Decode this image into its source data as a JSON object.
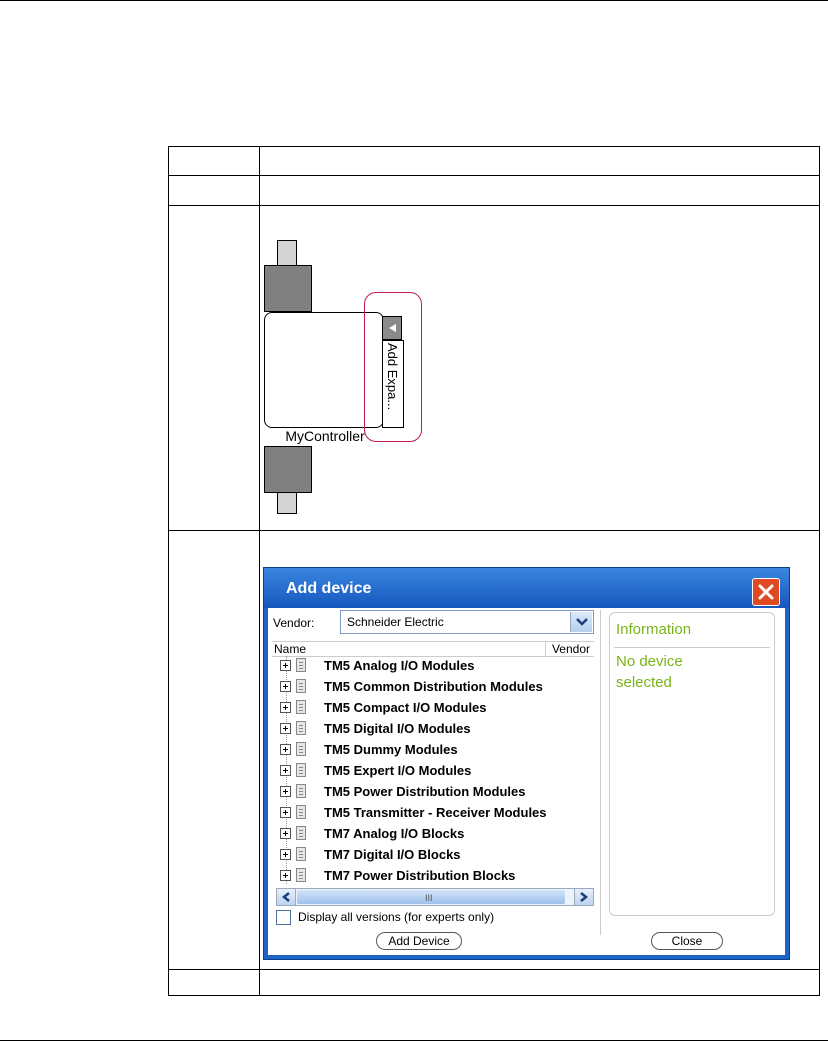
{
  "diagram": {
    "controller_label": "MyController",
    "expansion_button_label": "Add Expa..."
  },
  "dialog": {
    "title": "Add device",
    "vendor_label": "Vendor:",
    "vendor_value": "Schneider Electric",
    "columns": {
      "name": "Name",
      "vendor": "Vendor"
    },
    "tree_items": [
      "TM5 Analog I/O Modules",
      "TM5 Common Distribution Modules",
      "TM5 Compact I/O Modules",
      "TM5 Digital I/O Modules",
      "TM5 Dummy Modules",
      "TM5 Expert I/O Modules",
      "TM5 Power Distribution Modules",
      "TM5 Transmitter - Receiver Modules",
      "TM7 Analog I/O Blocks",
      "TM7 Digital I/O Blocks",
      "TM7 Power Distribution Blocks"
    ],
    "scroll_grip": "III",
    "show_all_label": "Display all versions (for experts only)",
    "add_button": "Add Device",
    "close_button": "Close",
    "info": {
      "title": "Information",
      "message": "No device selected"
    },
    "colors": {
      "titlebar": "#1d63c8",
      "close": "#e04a22",
      "info_text": "#7bb31a"
    },
    "icons": {
      "close": "close-x-icon",
      "dropdown": "chevron-down-icon",
      "tree_expand": "plus-box-icon",
      "tree_item": "device-library-icon",
      "scroll_left": "arrow-left-icon",
      "scroll_right": "arrow-right-icon"
    }
  }
}
